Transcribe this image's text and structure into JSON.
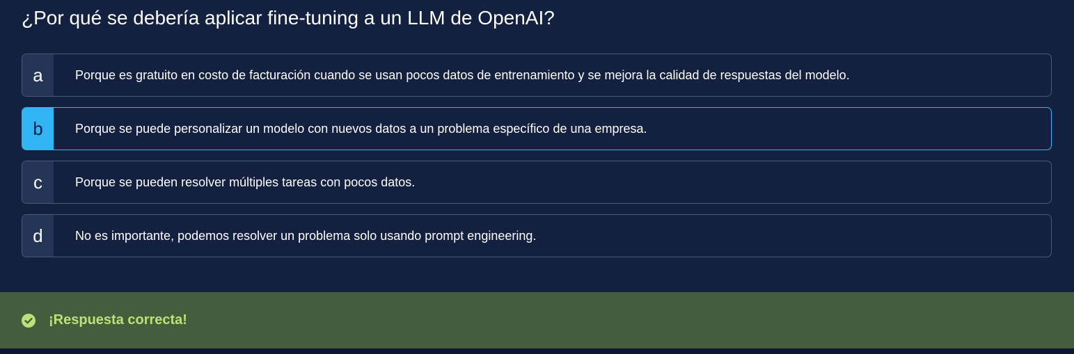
{
  "question": "¿Por qué se debería aplicar fine-tuning a un LLM de OpenAI?",
  "options": [
    {
      "letter": "a",
      "text": "Porque es gratuito en costo de facturación cuando se usan pocos datos de entrenamiento y se mejora la calidad de respuestas del modelo."
    },
    {
      "letter": "b",
      "text": "Porque se puede personalizar un modelo con nuevos datos a un problema específico de una empresa."
    },
    {
      "letter": "c",
      "text": "Porque se pueden resolver múltiples tareas con pocos datos."
    },
    {
      "letter": "d",
      "text": "No es importante, podemos resolver un problema solo usando prompt engineering."
    }
  ],
  "selected_option": "b",
  "feedback": {
    "icon": "check-circle-icon",
    "label": "¡Respuesta correcta!"
  },
  "colors": {
    "background": "#13203f",
    "selected_accent": "#32b5f5",
    "success_bg": "#455d3d",
    "success_text": "#b8e376"
  }
}
